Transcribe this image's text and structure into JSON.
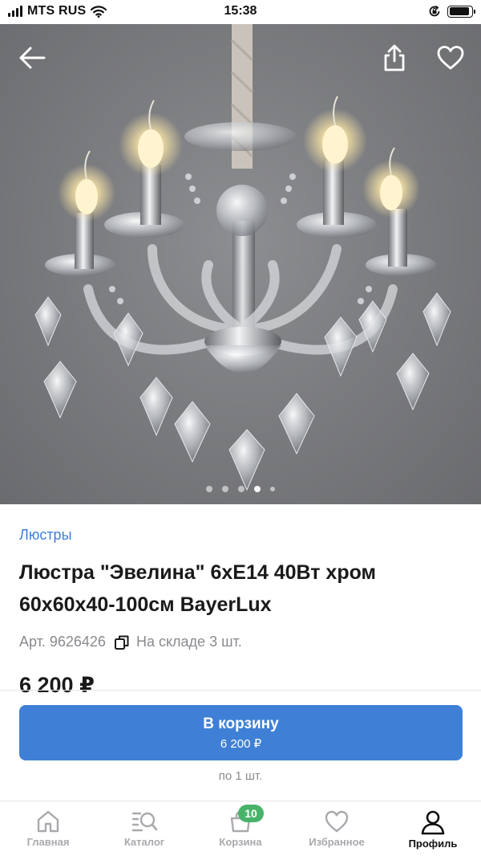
{
  "status_bar": {
    "carrier": "MTS RUS",
    "time": "15:38",
    "battery_level": 0.9
  },
  "hero": {
    "image_alt": "Люстра Эвелина",
    "slide_count": 5,
    "active_slide": 4,
    "icons": {
      "back": "arrow-left-icon",
      "share": "share-icon",
      "favorite": "heart-outline-icon"
    }
  },
  "product": {
    "category": "Люстры",
    "title": "Люстра \"Эвелина\" 6xE14 40Вт хром 60х60х40-100см BayerLux",
    "article": "Арт. 9626426",
    "stock": "На складе 3 шт.",
    "price": "6 200 ₽"
  },
  "cart": {
    "button_label": "В корзину",
    "button_price": "6 200 ₽",
    "per_unit": "по 1 шт."
  },
  "tabbar": {
    "items": [
      {
        "label": "Главная",
        "icon": "home-icon"
      },
      {
        "label": "Каталог",
        "icon": "catalog-search-icon"
      },
      {
        "label": "Корзина",
        "icon": "bag-icon",
        "badge": "10"
      },
      {
        "label": "Избранное",
        "icon": "heart-icon"
      },
      {
        "label": "Профиль",
        "icon": "profile-icon"
      }
    ],
    "active_index": 4
  },
  "colors": {
    "accent": "#3f80d6",
    "badge": "#49b36a",
    "muted": "#8a8a8f"
  }
}
